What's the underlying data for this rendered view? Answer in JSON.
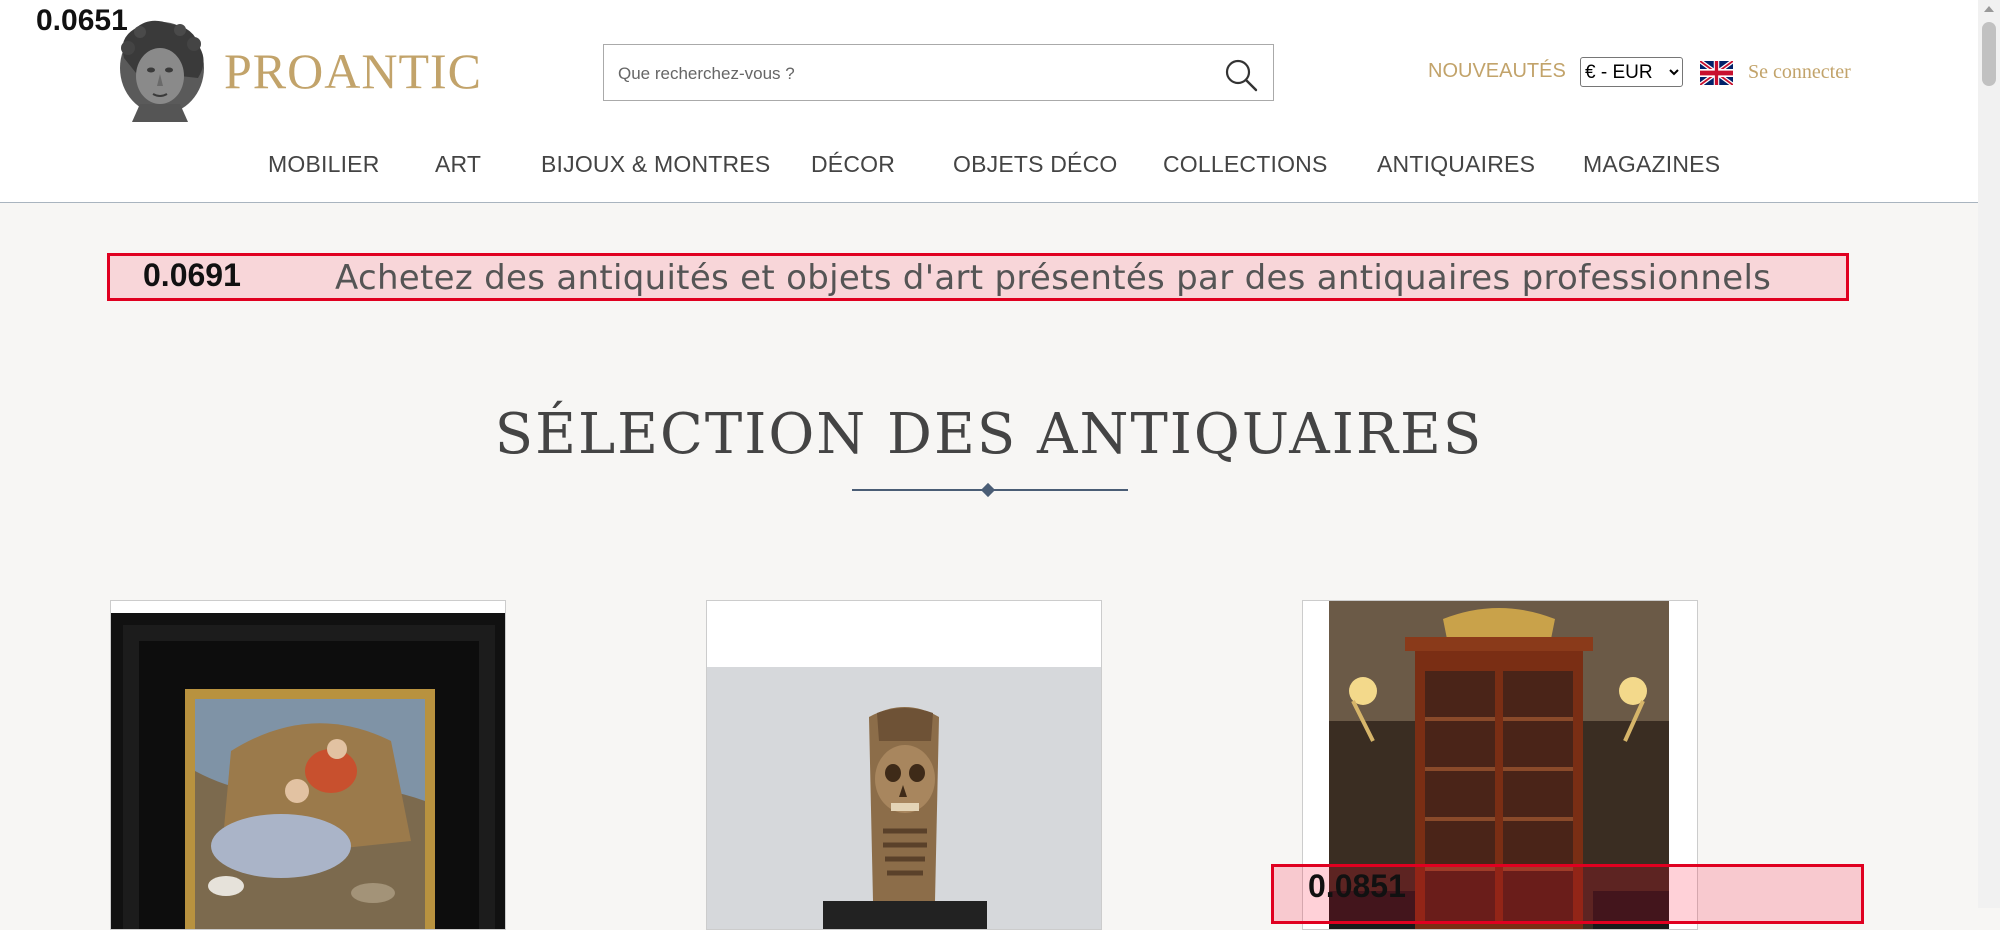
{
  "scores": {
    "top_left": "0.0651",
    "tagline": "0.0691",
    "bottom_right": "0.0851"
  },
  "header": {
    "brand": "PROANTIC",
    "search_placeholder": "Que recherchez-vous ?",
    "new_link": "NOUVEAUTÉS",
    "currency_selected": "€ - EUR",
    "language_icon": "uk-flag-icon",
    "login_link": "Se connecter"
  },
  "nav": {
    "items": [
      {
        "label": "MOBILIER"
      },
      {
        "label": "ART"
      },
      {
        "label": "BIJOUX & MONTRES"
      },
      {
        "label": "DÉCOR"
      },
      {
        "label": "OBJETS DÉCO"
      },
      {
        "label": "COLLECTIONS"
      },
      {
        "label": "ANTIQUAIRES"
      },
      {
        "label": "MAGAZINES"
      }
    ]
  },
  "main": {
    "tagline": "Achetez des antiquités et objets d'art présentés par des antiquaires professionnels",
    "section_title": "SÉLECTION DES ANTIQUAIRES",
    "cards": [
      {
        "image_icon": "framed-painting-image"
      },
      {
        "image_icon": "carved-skull-sculpture-image"
      },
      {
        "image_icon": "mahogany-bookcase-image"
      }
    ]
  },
  "colors": {
    "accent_gold": "#c2a36a",
    "navy_rule": "#4a5d75",
    "highlight_red": "#e00020",
    "page_bg": "#f7f6f4"
  }
}
